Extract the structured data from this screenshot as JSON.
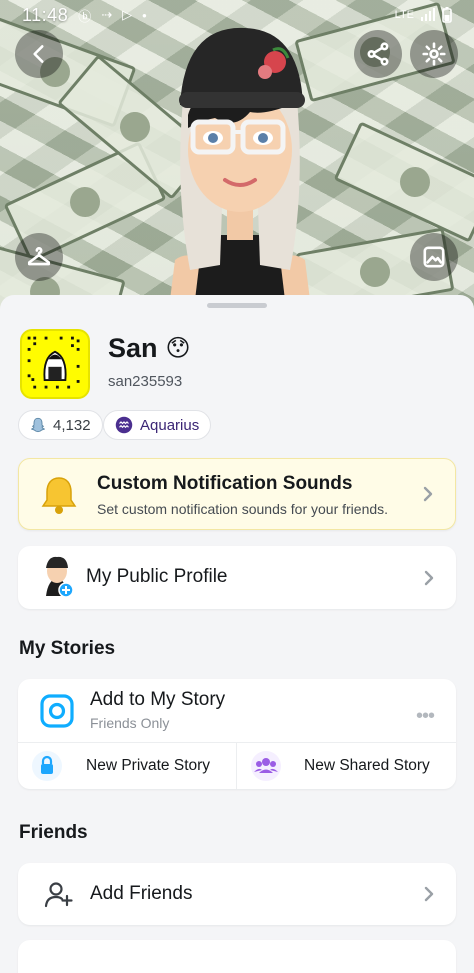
{
  "status_bar": {
    "time": "11:48",
    "network": "LTE"
  },
  "profile": {
    "display_name": "San",
    "name_emoji": "😯",
    "username": "san235593",
    "score": "4,132",
    "zodiac": "Aquarius"
  },
  "notification_card": {
    "title": "Custom Notification Sounds",
    "subtitle": "Set custom notification sounds for your friends."
  },
  "public_profile": {
    "label": "My Public Profile"
  },
  "my_stories": {
    "section_title": "My Stories",
    "add_story_title": "Add to My Story",
    "add_story_subtitle": "Friends Only",
    "more": "•••",
    "private_story": "New Private Story",
    "shared_story": "New Shared Story"
  },
  "friends": {
    "section_title": "Friends",
    "add_friends": "Add Friends"
  },
  "colors": {
    "snap_yellow": "#FFFC00",
    "story_blue": "#0FADFF",
    "lock_blue": "#1EA7FD",
    "group_purple": "#9B5DE5",
    "zodiac_purple": "#3B2675"
  },
  "icons": [
    "back-arrow-icon",
    "share-icon",
    "settings-gear-icon",
    "hanger-icon",
    "image-icon",
    "bell-icon",
    "camera-icon",
    "lock-icon",
    "group-icon",
    "add-friend-icon",
    "chevron-right-icon"
  ]
}
